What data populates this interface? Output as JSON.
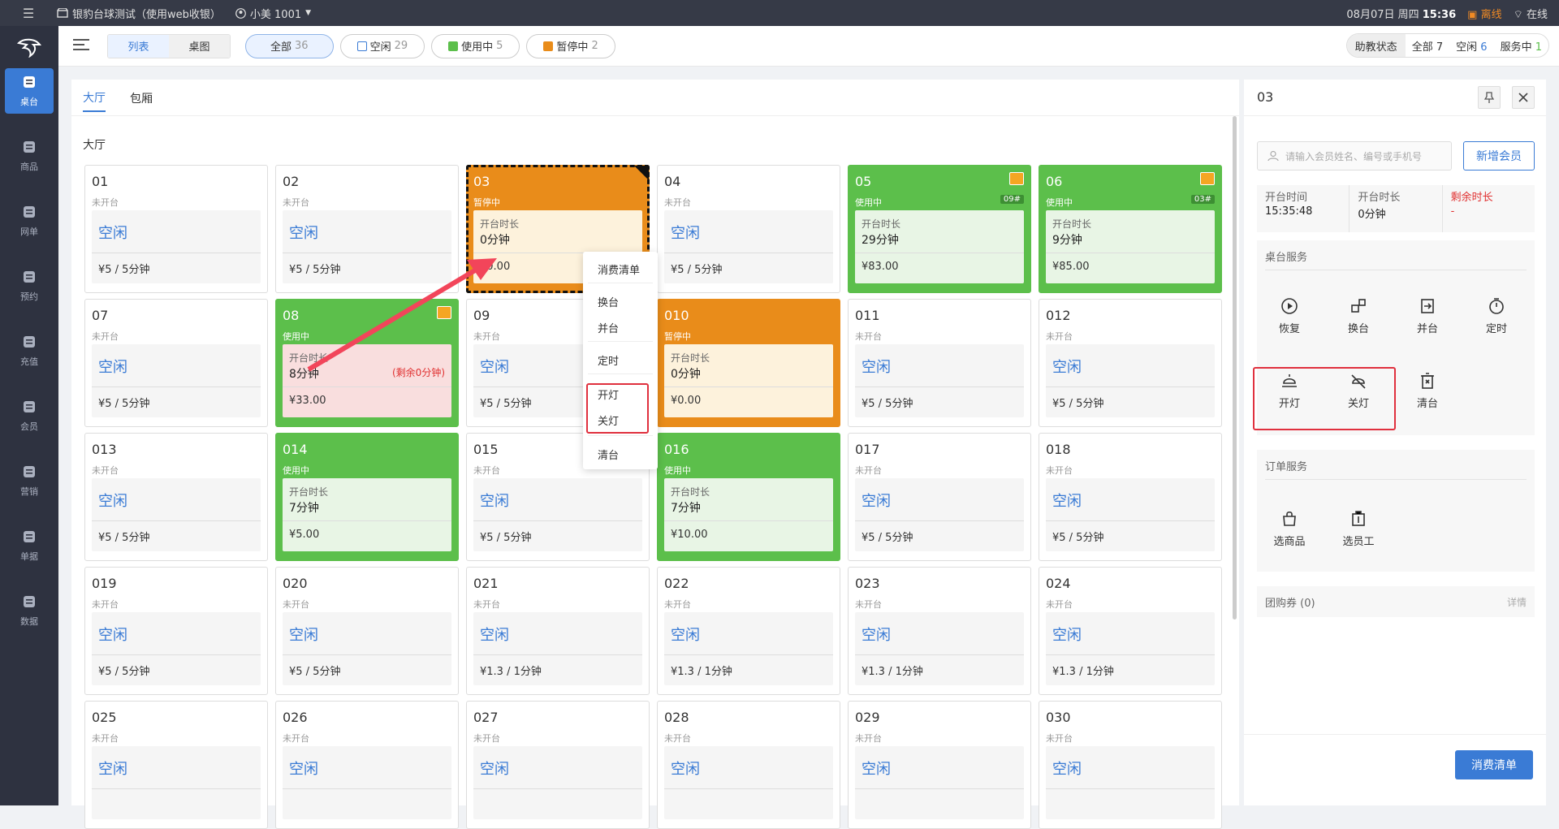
{
  "topbar": {
    "store": "银豹台球测试（使用web收银）",
    "user": "小美 1001",
    "date": "08月07日 周四",
    "time": "15:36",
    "offline": "离线",
    "online": "在线"
  },
  "sidebar": [
    {
      "label": "桌台",
      "icon": "table-icon"
    },
    {
      "label": "商品",
      "icon": "goods-icon"
    },
    {
      "label": "网单",
      "icon": "online-order-icon"
    },
    {
      "label": "预约",
      "icon": "reserve-icon"
    },
    {
      "label": "充值",
      "icon": "recharge-icon"
    },
    {
      "label": "会员",
      "icon": "member-icon"
    },
    {
      "label": "营销",
      "icon": "marketing-icon"
    },
    {
      "label": "单据",
      "icon": "receipt-icon"
    },
    {
      "label": "数据",
      "icon": "data-icon"
    }
  ],
  "toolbar": {
    "view_list": "列表",
    "view_map": "桌图",
    "filters": [
      {
        "label": "全部",
        "count": "36"
      },
      {
        "label": "空闲",
        "count": "29"
      },
      {
        "label": "使用中",
        "count": "5"
      },
      {
        "label": "暂停中",
        "count": "2"
      }
    ],
    "assist": {
      "label": "助教状态",
      "all": "全部",
      "all_n": "7",
      "idle": "空闲",
      "idle_n": "6",
      "serving": "服务中",
      "serving_n": "1"
    }
  },
  "tabs": [
    "大厅",
    "包厢"
  ],
  "section": "大厅",
  "labels": {
    "duration": "开台时长",
    "idle": "空闲"
  },
  "colors": {
    "accent": "#3a7bd5",
    "in_use": "#5cbf4b",
    "paused": "#e98c1a",
    "alert": "#e0303e"
  },
  "tables": [
    {
      "no": "01",
      "status": "未开台",
      "type": "idle",
      "price": "¥5 / 5分钟"
    },
    {
      "no": "02",
      "status": "未开台",
      "type": "idle",
      "price": "¥5 / 5分钟"
    },
    {
      "no": "03",
      "status": "暂停中",
      "type": "paused",
      "duration": "0分钟",
      "price": "¥0.00",
      "selected": true
    },
    {
      "no": "04",
      "status": "未开台",
      "type": "idle",
      "price": "¥5 / 5分钟"
    },
    {
      "no": "05",
      "status": "使用中",
      "type": "inuse",
      "duration": "29分钟",
      "price": "¥83.00",
      "tag": "09#",
      "cart": true
    },
    {
      "no": "06",
      "status": "使用中",
      "type": "inuse",
      "duration": "9分钟",
      "price": "¥85.00",
      "tag": "03#",
      "cart": true
    },
    {
      "no": "07",
      "status": "未开台",
      "type": "idle",
      "price": "¥5 / 5分钟"
    },
    {
      "no": "08",
      "status": "使用中",
      "type": "inuse",
      "duration": "8分钟",
      "price": "¥33.00",
      "remain": "(剩余0分钟)",
      "cart": true,
      "alert": true
    },
    {
      "no": "09",
      "status": "未开台",
      "type": "idle",
      "price": "¥5 / 5分钟"
    },
    {
      "no": "010",
      "status": "暂停中",
      "type": "paused",
      "duration": "0分钟",
      "price": "¥0.00"
    },
    {
      "no": "011",
      "status": "未开台",
      "type": "idle",
      "price": "¥5 / 5分钟"
    },
    {
      "no": "012",
      "status": "未开台",
      "type": "idle",
      "price": "¥5 / 5分钟"
    },
    {
      "no": "013",
      "status": "未开台",
      "type": "idle",
      "price": "¥5 / 5分钟"
    },
    {
      "no": "014",
      "status": "使用中",
      "type": "inuse",
      "duration": "7分钟",
      "price": "¥5.00"
    },
    {
      "no": "015",
      "status": "未开台",
      "type": "idle",
      "price": "¥5 / 5分钟"
    },
    {
      "no": "016",
      "status": "使用中",
      "type": "inuse",
      "duration": "7分钟",
      "price": "¥10.00"
    },
    {
      "no": "017",
      "status": "未开台",
      "type": "idle",
      "price": "¥5 / 5分钟"
    },
    {
      "no": "018",
      "status": "未开台",
      "type": "idle",
      "price": "¥5 / 5分钟"
    },
    {
      "no": "019",
      "status": "未开台",
      "type": "idle",
      "price": "¥5 / 5分钟"
    },
    {
      "no": "020",
      "status": "未开台",
      "type": "idle",
      "price": "¥5 / 5分钟"
    },
    {
      "no": "021",
      "status": "未开台",
      "type": "idle",
      "price": "¥1.3 / 1分钟"
    },
    {
      "no": "022",
      "status": "未开台",
      "type": "idle",
      "price": "¥1.3 / 1分钟"
    },
    {
      "no": "023",
      "status": "未开台",
      "type": "idle",
      "price": "¥1.3 / 1分钟"
    },
    {
      "no": "024",
      "status": "未开台",
      "type": "idle",
      "price": "¥1.3 / 1分钟"
    },
    {
      "no": "025",
      "status": "未开台",
      "type": "idle",
      "price": ""
    },
    {
      "no": "026",
      "status": "未开台",
      "type": "idle",
      "price": ""
    },
    {
      "no": "027",
      "status": "未开台",
      "type": "idle",
      "price": ""
    },
    {
      "no": "028",
      "status": "未开台",
      "type": "idle",
      "price": ""
    },
    {
      "no": "029",
      "status": "未开台",
      "type": "idle",
      "price": ""
    },
    {
      "no": "030",
      "status": "未开台",
      "type": "idle",
      "price": ""
    }
  ],
  "context_menu": [
    "消费清单",
    "换台",
    "并台",
    "定时",
    "开灯",
    "关灯",
    "清台"
  ],
  "panel": {
    "title": "03",
    "search_placeholder": "请输入会员姓名、编号或手机号",
    "add_member": "新增会员",
    "info": [
      {
        "label": "开台时间",
        "value": "15:35:48"
      },
      {
        "label": "开台时长",
        "value": "0分钟"
      },
      {
        "label": "剩余时长",
        "value": "-"
      }
    ],
    "table_service": "桌台服务",
    "table_buttons": [
      "恢复",
      "换台",
      "并台",
      "定时",
      "开灯",
      "关灯",
      "清台"
    ],
    "order_service": "订单服务",
    "order_buttons": [
      "选商品",
      "选员工"
    ],
    "group": "团购券 (0)",
    "detail": "详情",
    "bill": "消费清单"
  }
}
